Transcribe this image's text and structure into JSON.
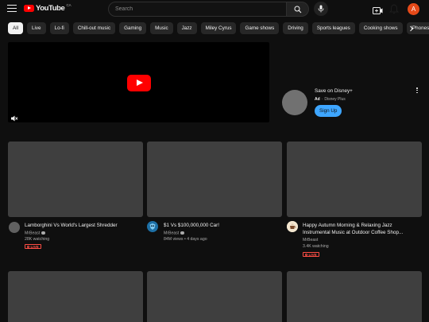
{
  "header": {
    "logo_text": "YouTube",
    "country": "CA",
    "search_placeholder": "Search",
    "avatar_letter": "A"
  },
  "chips": [
    "All",
    "Live",
    "Lo-fi",
    "Chill-out music",
    "Gaming",
    "Music",
    "Jazz",
    "Miley Cyrus",
    "Game shows",
    "Driving",
    "Sports leagues",
    "Cooking shows",
    "iPhones"
  ],
  "ad": {
    "title": "Save on Disney+",
    "label": "Ad",
    "separator": "·",
    "advertiser": "Disney Plus",
    "button": "Sign Up"
  },
  "videos": [
    {
      "title": "Lamborghini Vs World's Largest Shredder",
      "channel": "MrBeast",
      "meta": "28K watching",
      "live": "LIVE"
    },
    {
      "title": "$1 Vs $100,000,000 Car!",
      "channel": "MrBeast",
      "meta": "84M views • 4 days ago",
      "live": ""
    },
    {
      "title": "Happy Autumn Morning & Relaxing Jazz Instrumental Music at Outdoor Coffee Shop...",
      "channel": "MrBeast",
      "meta": "3.4K watching",
      "live": "LIVE"
    }
  ],
  "colors": {
    "background": "#0f0f0f",
    "brand_red": "#ff0000",
    "live_red": "#ff4e45",
    "signup_blue": "#3ea6ff"
  }
}
